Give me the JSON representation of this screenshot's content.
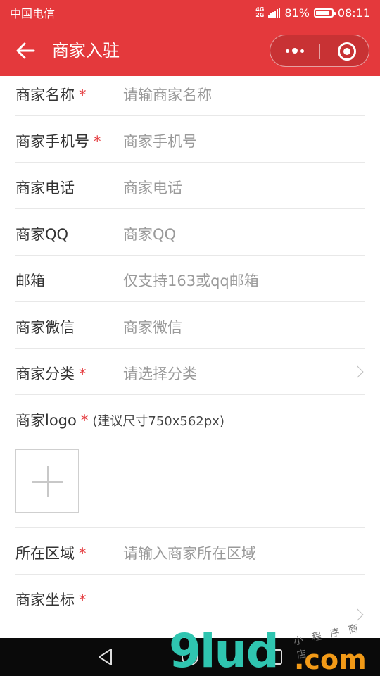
{
  "status_bar": {
    "carrier": "中国电信",
    "network": [
      "4G",
      "2G"
    ],
    "battery_percent": "81%",
    "battery_level": 0.81,
    "time": "08:11"
  },
  "nav": {
    "title": "商家入驻"
  },
  "form": {
    "fields": [
      {
        "label": "商家名称",
        "required": "*",
        "placeholder": "请输商家名称"
      },
      {
        "label": "商家手机号",
        "required": "*",
        "placeholder": "商家手机号"
      },
      {
        "label": "商家电话",
        "placeholder": "商家电话"
      },
      {
        "label": "商家QQ",
        "placeholder": "商家QQ"
      },
      {
        "label": "邮箱",
        "placeholder": "仅支持163或qq邮箱"
      },
      {
        "label": "商家微信",
        "placeholder": "商家微信"
      },
      {
        "label": "商家分类",
        "required": "*",
        "placeholder": "请选择分类"
      }
    ],
    "logo": {
      "label": "商家logo",
      "required": "*",
      "hint": "(建议尺寸750x562px)"
    },
    "region": {
      "label": "所在区域",
      "required": "*",
      "placeholder": "请输入商家所在区域"
    },
    "coords": {
      "label": "商家坐标",
      "required": "*"
    }
  },
  "watermark": {
    "main": "9lud",
    "suffix": ".com",
    "small": "小 程 序 商 店"
  }
}
